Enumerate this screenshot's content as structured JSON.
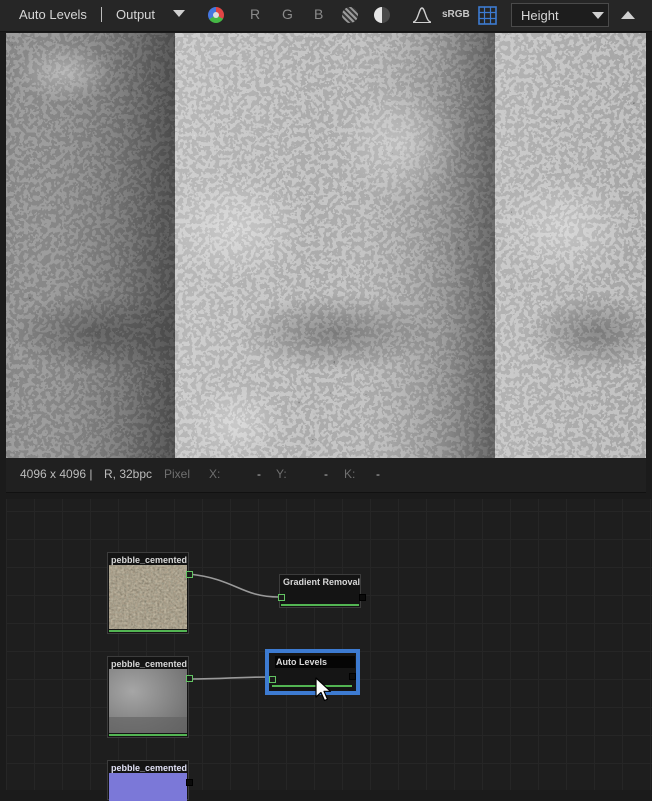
{
  "toolbar": {
    "node_name": "Auto Levels",
    "output_label": "Output",
    "channels": [
      "R",
      "G",
      "B"
    ],
    "colorspace": "sRGB",
    "view_mode": "Height"
  },
  "info": {
    "resolution": "4096 x 4096 |",
    "format": "R, 32bpc",
    "pixel_label": "Pixel",
    "x_label": "X:",
    "x_value": "-",
    "y_label": "Y:",
    "y_value": "-",
    "k_label": "K:",
    "k_value": "-"
  },
  "graph": {
    "nodes": [
      {
        "title": "pebble_cemented"
      },
      {
        "title": "Gradient Removal"
      },
      {
        "title": "pebble_cemented"
      },
      {
        "title": "Auto Levels"
      },
      {
        "title": "pebble_cemented"
      }
    ]
  },
  "colors": {
    "selection": "#3d7bd1",
    "port_green": "#62c362",
    "output_bar": "#53b553",
    "normal_thumb": "#7b78d8"
  },
  "icons": [
    "color-wheel-icon",
    "sphere-icon",
    "shading-icon",
    "histogram-icon",
    "tiling-grid-icon",
    "chevron-down-icon",
    "collapse-up-icon",
    "cursor-icon"
  ]
}
